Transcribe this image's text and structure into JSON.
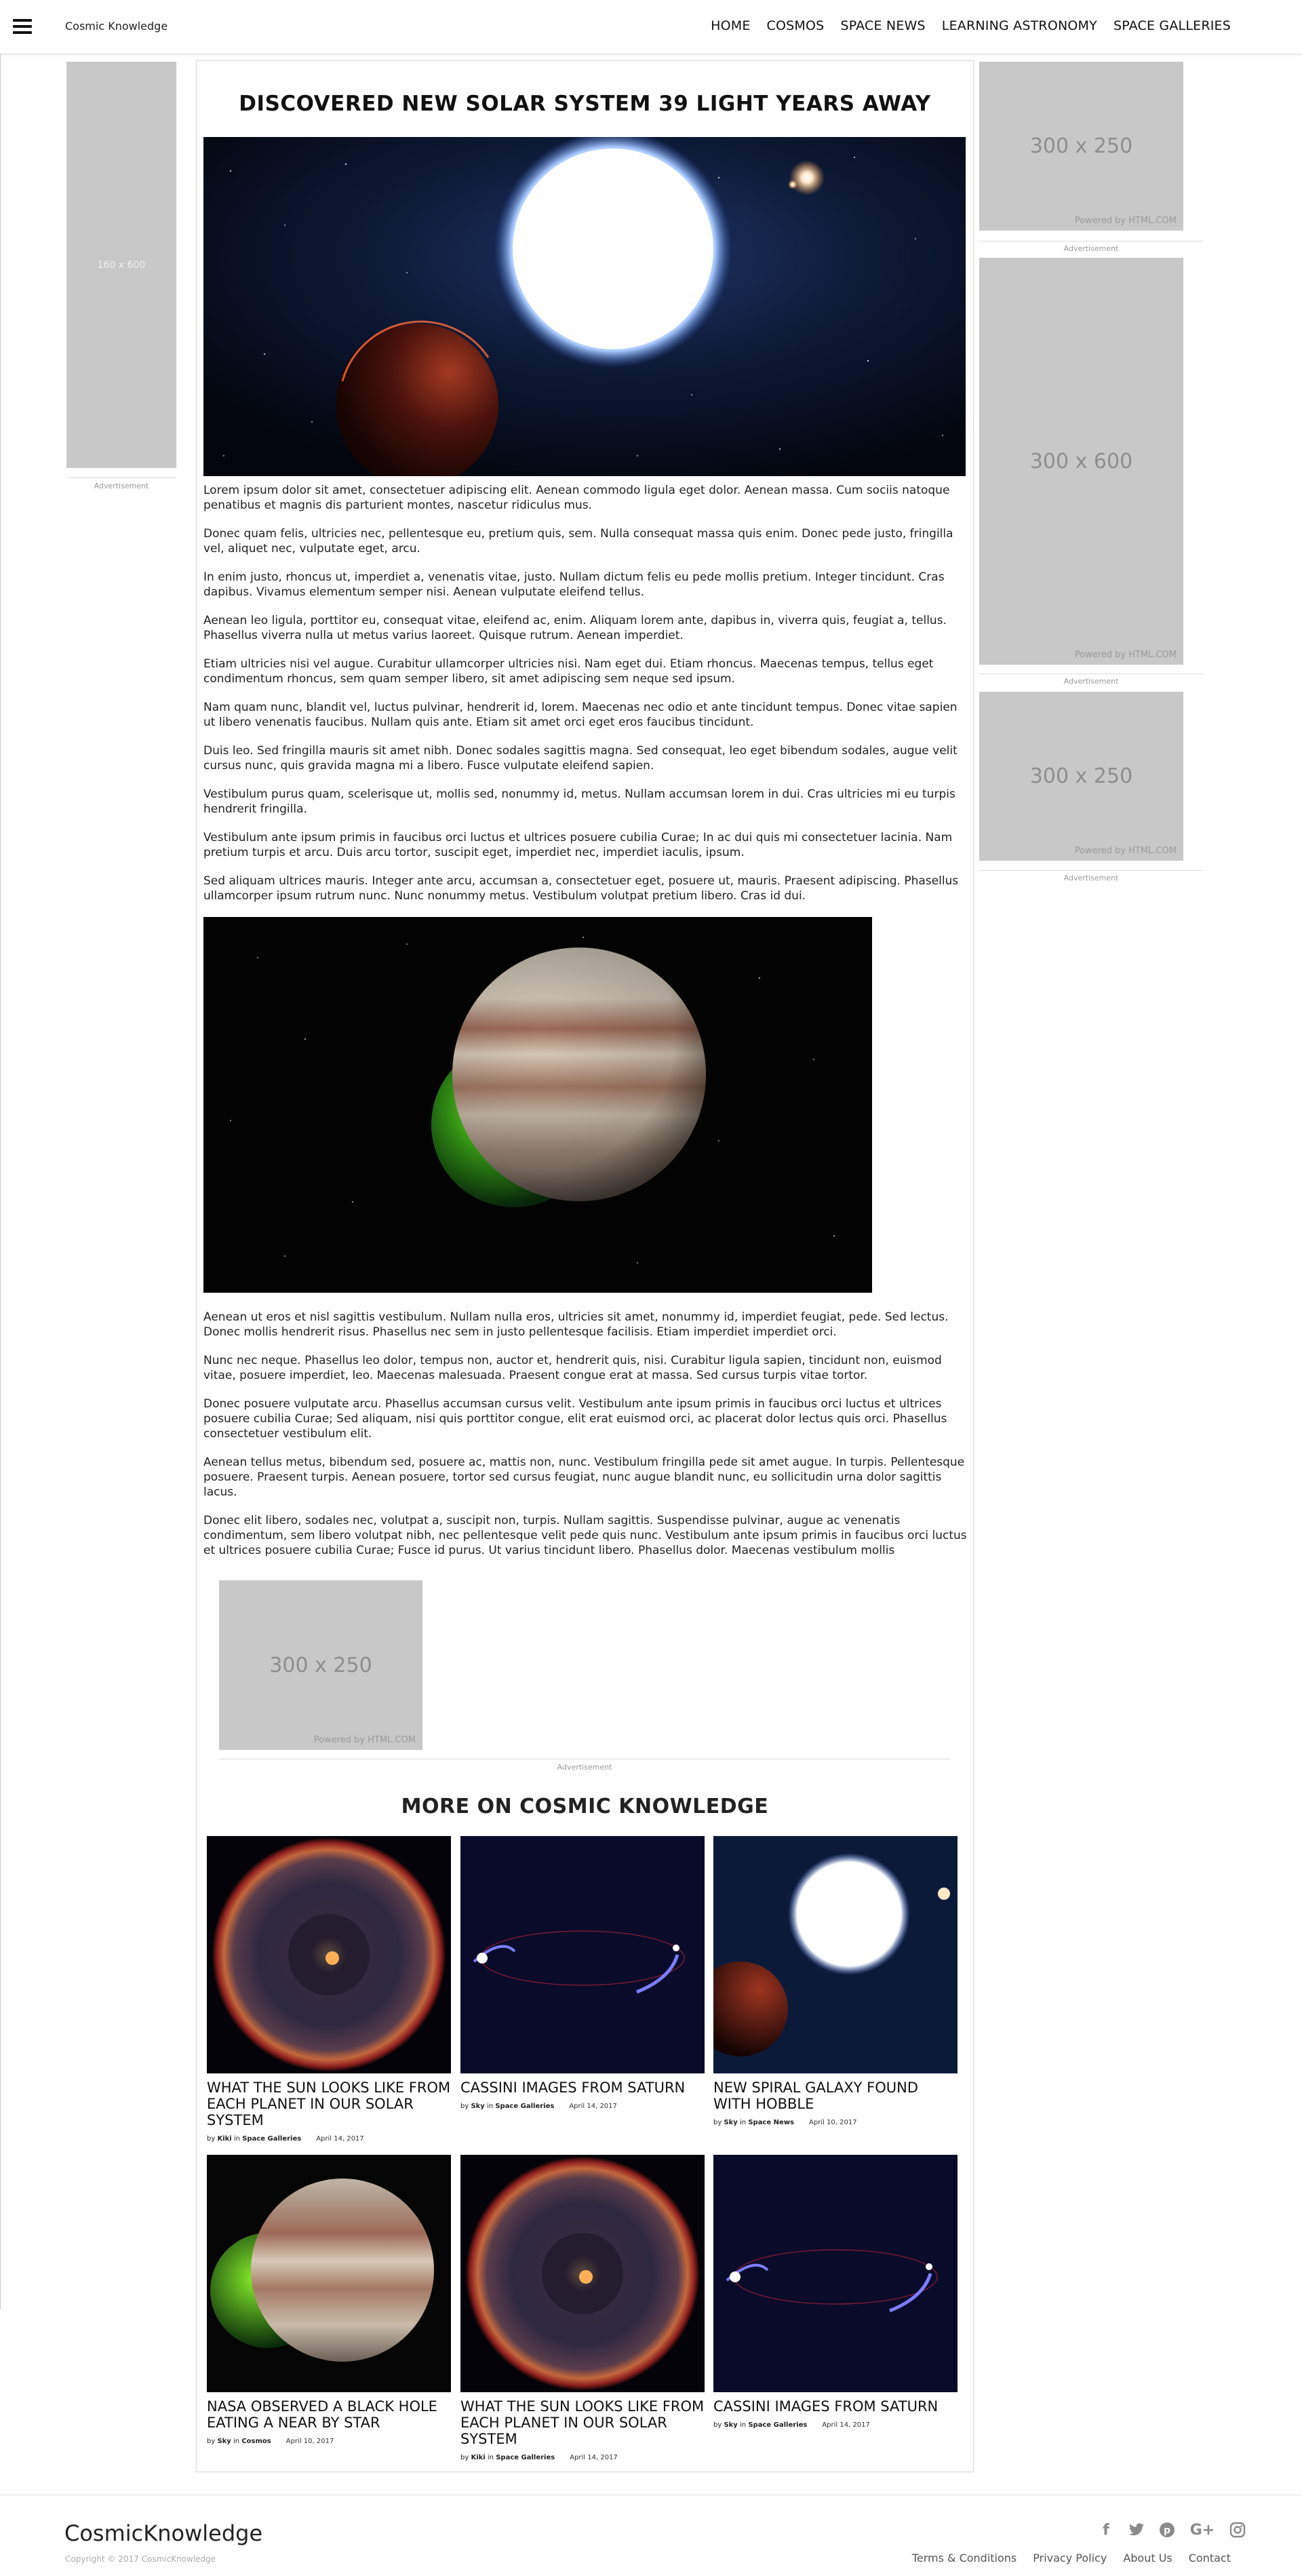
{
  "header": {
    "brand": "Cosmic Knowledge",
    "nav": [
      "HOME",
      "COSMOS",
      "SPACE NEWS",
      "LEARNING ASTRONOMY",
      "SPACE GALLERIES"
    ]
  },
  "ads": {
    "left": {
      "size": "160 x 600",
      "caption": "Advertisement"
    },
    "right_top": {
      "size": "300 x 250",
      "powered": "Powered by HTML.COM",
      "caption": "Advertisement"
    },
    "right_mid": {
      "size": "300 x 600",
      "powered": "Powered by HTML.COM",
      "caption": "Advertisement"
    },
    "right_bottom": {
      "size": "300 x 250",
      "powered": "Powered by HTML.COM",
      "caption": "Advertisement"
    },
    "inline": {
      "size": "300 x 250",
      "powered": "Powered by HTML.COM",
      "caption": "Advertisement"
    }
  },
  "article": {
    "title": "DISCOVERED NEW SOLAR SYSTEM 39 LIGHT YEARS AWAY",
    "paragraphs": [
      "Lorem ipsum dolor sit amet, consectetuer adipiscing elit. Aenean commodo ligula eget dolor. Aenean massa. Cum sociis natoque penatibus et magnis dis parturient montes, nascetur ridiculus mus.",
      "Donec quam felis, ultricies nec, pellentesque eu, pretium quis, sem. Nulla consequat massa quis enim. Donec pede justo, fringilla vel, aliquet nec, vulputate eget, arcu.",
      "In enim justo, rhoncus ut, imperdiet a, venenatis vitae, justo. Nullam dictum felis eu pede mollis pretium. Integer tincidunt. Cras dapibus. Vivamus elementum semper nisi. Aenean vulputate eleifend tellus.",
      "Aenean leo ligula, porttitor eu, consequat vitae, eleifend ac, enim. Aliquam lorem ante, dapibus in, viverra quis, feugiat a, tellus. Phasellus viverra nulla ut metus varius laoreet. Quisque rutrum. Aenean imperdiet.",
      "Etiam ultricies nisi vel augue. Curabitur ullamcorper ultricies nisi. Nam eget dui. Etiam rhoncus. Maecenas tempus, tellus eget condimentum rhoncus, sem quam semper libero, sit amet adipiscing sem neque sed ipsum.",
      "Nam quam nunc, blandit vel, luctus pulvinar, hendrerit id, lorem. Maecenas nec odio et ante tincidunt tempus. Donec vitae sapien ut libero venenatis faucibus. Nullam quis ante. Etiam sit amet orci eget eros faucibus tincidunt.",
      "Duis leo. Sed fringilla mauris sit amet nibh. Donec sodales sagittis magna. Sed consequat, leo eget bibendum sodales, augue velit cursus nunc, quis gravida magna mi a libero. Fusce vulputate eleifend sapien.",
      "Vestibulum purus quam, scelerisque ut, mollis sed, nonummy id, metus. Nullam accumsan lorem in dui. Cras ultricies mi eu turpis hendrerit fringilla.",
      "Vestibulum ante ipsum primis in faucibus orci luctus et ultrices posuere cubilia Curae; In ac dui quis mi consectetuer lacinia. Nam pretium turpis et arcu. Duis arcu tortor, suscipit eget, imperdiet nec, imperdiet iaculis, ipsum.",
      "Sed aliquam ultrices mauris. Integer ante arcu, accumsan a, consectetuer eget, posuere ut, mauris. Praesent adipiscing. Phasellus ullamcorper ipsum rutrum nunc. Nunc nonummy metus. Vestibulum volutpat pretium libero. Cras id dui.",
      "Aenean ut eros et nisl sagittis vestibulum. Nullam nulla eros, ultricies sit amet, nonummy id, imperdiet feugiat, pede. Sed lectus. Donec mollis hendrerit risus. Phasellus nec sem in justo pellentesque facilisis. Etiam imperdiet imperdiet orci.",
      "Nunc nec neque. Phasellus leo dolor, tempus non, auctor et, hendrerit quis, nisi. Curabitur ligula sapien, tincidunt non, euismod vitae, posuere imperdiet, leo. Maecenas malesuada. Praesent congue erat at massa. Sed cursus turpis vitae tortor.",
      "Donec posuere vulputate arcu. Phasellus accumsan cursus velit. Vestibulum ante ipsum primis in faucibus orci luctus et ultrices posuere cubilia Curae; Sed aliquam, nisi quis porttitor congue, elit erat euismod orci, ac placerat dolor lectus quis orci. Phasellus consectetuer vestibulum elit.",
      "Aenean tellus metus, bibendum sed, posuere ac, mattis non, nunc. Vestibulum fringilla pede sit amet augue. In turpis. Pellentesque posuere. Praesent turpis. Aenean posuere, tortor sed cursus feugiat, nunc augue blandit nunc, eu sollicitudin urna dolor sagittis lacus.",
      "Donec elit libero, sodales nec, volutpat a, suscipit non, turpis. Nullam sagittis. Suspendisse pulvinar, augue ac venenatis condimentum, sem libero volutpat nibh, nec pellentesque velit pede quis nunc. Vestibulum ante ipsum primis in faucibus orci luctus et ultrices posuere cubilia Curae; Fusce id purus. Ut varius tincidunt libero. Phasellus dolor. Maecenas vestibulum mollis"
    ]
  },
  "more": {
    "heading": "MORE ON COSMIC KNOWLEDGE",
    "cards": [
      {
        "title": "WHAT THE SUN LOOKS LIKE FROM EACH PLANET IN OUR SOLAR SYSTEM",
        "by": "by",
        "author": "Kiki",
        "in": "in",
        "category": "Space Galleries",
        "date": "April 14, 2017",
        "image": "universe-ring"
      },
      {
        "title": "CASSINI IMAGES FROM SATURN",
        "by": "by",
        "author": "Sky",
        "in": "in",
        "category": "Space Galleries",
        "date": "April 14, 2017",
        "image": "orbit-streaks"
      },
      {
        "title": "NEW SPIRAL GALAXY FOUND WITH HOBBLE",
        "by": "by",
        "author": "Sky",
        "in": "in",
        "category": "Space News",
        "date": "April 10, 2017",
        "image": "white-star"
      },
      {
        "title": "NASA OBSERVED A BLACK HOLE EATING A NEAR BY STAR",
        "by": "by",
        "author": "Sky",
        "in": "in",
        "category": "Cosmos",
        "date": "April 10, 2017",
        "image": "gas-giant"
      },
      {
        "title": "WHAT THE SUN LOOKS LIKE FROM EACH PLANET IN OUR SOLAR SYSTEM",
        "by": "by",
        "author": "Kiki",
        "in": "in",
        "category": "Space Galleries",
        "date": "April 14, 2017",
        "image": "universe-ring"
      },
      {
        "title": "CASSINI IMAGES FROM SATURN",
        "by": "by",
        "author": "Sky",
        "in": "in",
        "category": "Space Galleries",
        "date": "April 14, 2017",
        "image": "orbit-streaks"
      }
    ]
  },
  "footer": {
    "brand": "CosmicKnowledge",
    "copyright": "Copyright © 2017 CosmicKnowledge",
    "social": [
      "facebook-icon",
      "twitter-icon",
      "pinterest-icon",
      "google-plus-icon",
      "instagram-icon"
    ],
    "links": [
      "Terms & Conditions",
      "Privacy Policy",
      "About Us",
      "Contact"
    ]
  }
}
